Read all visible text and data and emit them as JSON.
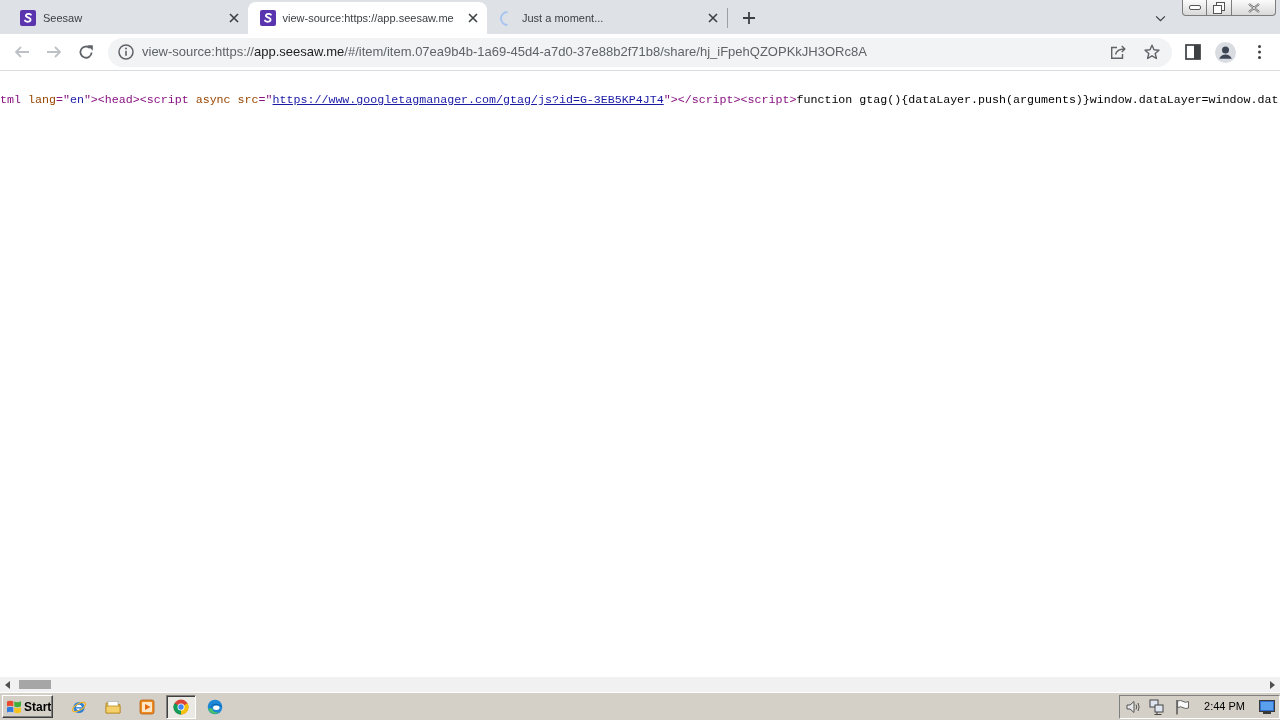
{
  "browser": {
    "tabs": [
      {
        "title": "Seesaw",
        "selected": false,
        "loading": false
      },
      {
        "title": "view-source:https://app.seesaw.me",
        "selected": true,
        "loading": false
      },
      {
        "title": "Just a moment...",
        "selected": false,
        "loading": true
      }
    ],
    "toolbar": {
      "back": {
        "disabled": true
      },
      "forward": {
        "disabled": true
      }
    },
    "address_bar": {
      "scheme": "view-source:https://",
      "host": "app.seesaw.me",
      "path": "/#/item/item.07ea9b4b-1a69-45d4-a7d0-37e88b2f71b8/share/hj_iFpehQZOPKkJH3ORc8A"
    }
  },
  "source_line": [
    {
      "kind": "tag",
      "text": "tml "
    },
    {
      "kind": "attr",
      "text": "lang"
    },
    {
      "kind": "tag",
      "text": "=\""
    },
    {
      "kind": "value",
      "text": "en"
    },
    {
      "kind": "tag",
      "text": "\"><head><script "
    },
    {
      "kind": "attr",
      "text": "async src"
    },
    {
      "kind": "tag",
      "text": "=\""
    },
    {
      "kind": "link",
      "text": "https://www.googletagmanager.com/gtag/js?id=G-3EB5KP4JT4"
    },
    {
      "kind": "tag",
      "text": "\"></script><script>"
    },
    {
      "kind": "text",
      "text": "function gtag(){dataLayer.push(arguments)}window.dataLayer=window.dat"
    }
  ],
  "taskbar": {
    "start": "Start",
    "items": [
      {
        "kind": "globe",
        "selected": false
      },
      {
        "kind": "folder",
        "selected": false
      },
      {
        "kind": "player",
        "selected": false
      },
      {
        "kind": "wheel",
        "selected": true
      },
      {
        "kind": "swirl",
        "selected": false
      }
    ],
    "clock": "2:44 PM"
  }
}
